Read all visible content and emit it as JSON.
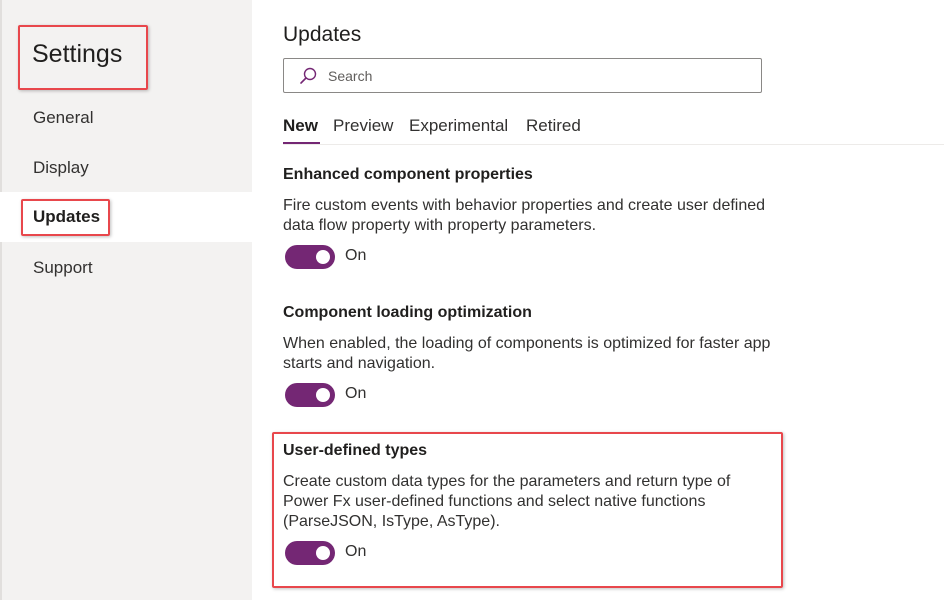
{
  "sidebar": {
    "title": "Settings",
    "items": [
      {
        "label": "General"
      },
      {
        "label": "Display"
      },
      {
        "label": "Updates"
      },
      {
        "label": "Support"
      }
    ],
    "active": "Updates"
  },
  "main": {
    "title": "Updates",
    "search": {
      "placeholder": "Search",
      "icon": "search-icon"
    },
    "tabs": [
      {
        "label": "New"
      },
      {
        "label": "Preview"
      },
      {
        "label": "Experimental"
      },
      {
        "label": "Retired"
      }
    ],
    "active_tab": "New",
    "settings": [
      {
        "title": "Enhanced component properties",
        "description": "Fire custom events with behavior properties and create user defined data flow property with property parameters.",
        "state": "On"
      },
      {
        "title": "Component loading optimization",
        "description": "When enabled, the loading of components is optimized for faster app starts and navigation.",
        "state": "On"
      },
      {
        "title": "User-defined types",
        "description": "Create custom data types for the parameters and return type of Power Fx user-defined functions and select native functions (ParseJSON, IsType, AsType).",
        "state": "On"
      }
    ]
  },
  "colors": {
    "accent": "#742774",
    "highlight": "#e8474c",
    "sidebar_bg": "#f3f2f1"
  }
}
